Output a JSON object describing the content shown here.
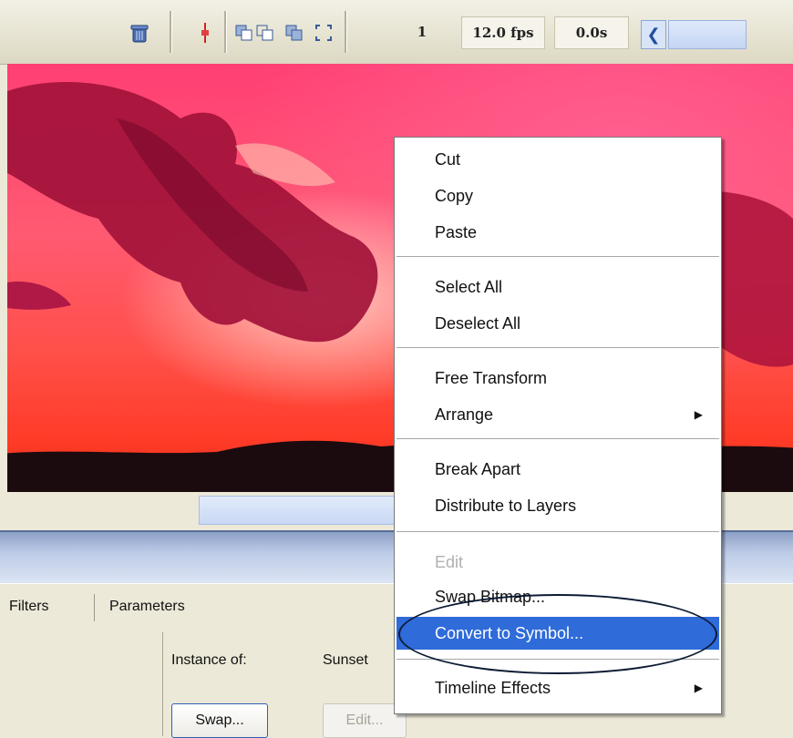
{
  "toolbar": {
    "frame_number": "1",
    "fps": "12.0 fps",
    "time": "0.0s",
    "icons": [
      "trash-icon",
      "center-frame-icon",
      "onion-skin-icon",
      "onion-outline-icon",
      "edit-multiple-frames-icon",
      "onion-markers-icon",
      "scroll-left-icon"
    ]
  },
  "panel": {
    "tabs": [
      "Filters",
      "Parameters"
    ],
    "instance_label": "Instance of:",
    "instance_value": "Sunset",
    "swap_button": "Swap...",
    "edit_button": "Edit..."
  },
  "context_menu": {
    "cut": "Cut",
    "copy": "Copy",
    "paste": "Paste",
    "select_all": "Select All",
    "deselect_all": "Deselect All",
    "free_transform": "Free Transform",
    "arrange": "Arrange",
    "break_apart": "Break Apart",
    "distribute_to_layers": "Distribute to Layers",
    "edit": "Edit",
    "swap_bitmap": "Swap Bitmap...",
    "convert_to_symbol": "Convert to Symbol...",
    "timeline_effects": "Timeline Effects",
    "submenu_arrow": "▶"
  },
  "colors": {
    "highlight": "#2f6bd9",
    "menu_bg": "#ffffff",
    "panel_bg": "#ece9d8"
  }
}
